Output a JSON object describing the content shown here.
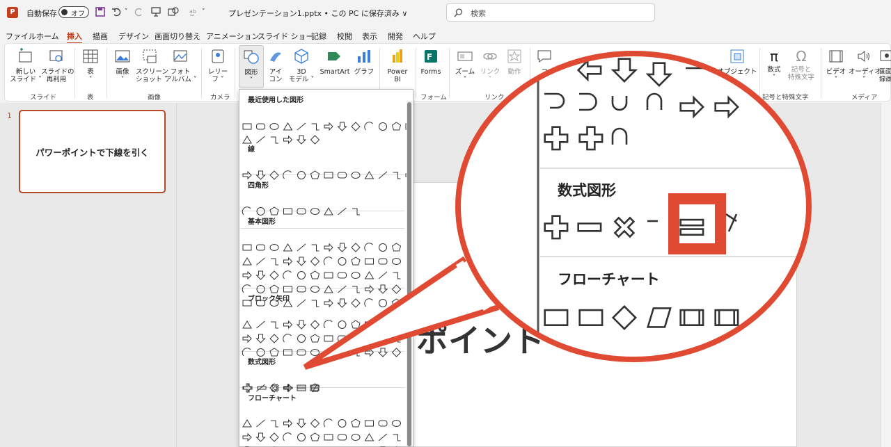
{
  "titlebar": {
    "app_logo": "P",
    "autosave_label": "自動保存",
    "autosave_state": "オフ",
    "doc_title": "プレゼンテーション1.pptx • この PC に保存済み ∨",
    "search_placeholder": "検索"
  },
  "menu": [
    "ファイル",
    "ホーム",
    "挿入",
    "描画",
    "デザイン",
    "画面切り替え",
    "アニメーション",
    "スライド ショー",
    "記録",
    "校閲",
    "表示",
    "開発",
    "ヘルプ"
  ],
  "ribbon": {
    "new_slide": "新しい\nスライド ˅",
    "reuse_slide": "スライドの\n再利用",
    "group_slide": "スライド",
    "table": "表\n˅",
    "group_table": "表",
    "image": "画像\n˅",
    "screenshot": "スクリーン\nショット ˅",
    "photo_album": "フォト\nアルバム ˅",
    "group_image": "画像",
    "cameo": "レリー\nフ ˅",
    "group_camera": "カメラ",
    "shapes": "図形\n˅",
    "icons": "アイ\nコン",
    "model3d": "3D\nモデル ˅",
    "smartart": "SmartArt",
    "chart": "グラフ",
    "powerbi": "Power\nBI",
    "forms": "Forms",
    "group_forms": "フォーム",
    "zoom": "ズーム\n˅",
    "link": "リンク\n˅",
    "action": "動作",
    "group_link": "リンク",
    "comment": "コ",
    "object": "オブジェクト",
    "equation": "数式\n˅",
    "symbol": "記号と\n特殊文字",
    "group_symbols": "記号と特殊文字",
    "video": "ビデオ\n˅",
    "audio": "オーディオ\n˅",
    "screen_rec": "画面\n録画",
    "group_media": "メディア"
  },
  "slides": {
    "number": "1",
    "thumb_text": "パワーポイントで下線を引く"
  },
  "slide_main_text": "ポイント",
  "dropdown": {
    "sections": [
      "最近使用した図形",
      "線",
      "四角形",
      "基本図形",
      "ブロック矢印",
      "数式図形",
      "フローチャート"
    ]
  },
  "zoom": {
    "math_title": "数式図形",
    "flow_title": "フローチャート"
  },
  "colors": {
    "accent": "#c43e1c",
    "callout": "#e04a33"
  }
}
